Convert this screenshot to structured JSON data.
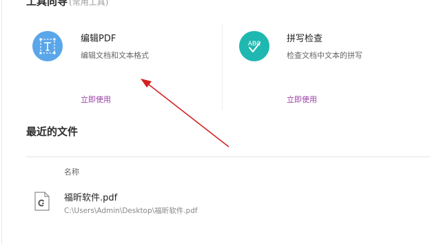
{
  "tools_section": {
    "title": "工具向导",
    "subtitle": "(常用工具)"
  },
  "tools": [
    {
      "name": "编辑PDF",
      "description": "编辑文档和文本格式",
      "action_label": "立即使用",
      "icon": "edit-text-icon",
      "icon_color": "#5aa6ea"
    },
    {
      "name": "拼写检查",
      "description": "检查文档中文本的拼写",
      "action_label": "立即使用",
      "icon": "spellcheck-icon",
      "icon_color": "#1fb8b0"
    }
  ],
  "recent": {
    "title": "最近的文件",
    "column_header": "名称",
    "files": [
      {
        "name": "福昕软件.pdf",
        "path": "C:\\Users\\Admin\\Desktop\\福昕软件.pdf",
        "icon": "pdf-file-icon"
      }
    ]
  },
  "annotation": {
    "type": "arrow",
    "color": "#d42020"
  },
  "colors": {
    "link": "#9b3fa6",
    "divider": "#e2e2e2"
  }
}
